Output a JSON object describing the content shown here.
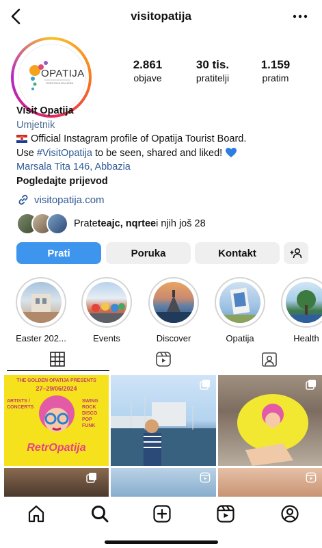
{
  "header": {
    "title": "visitopatija"
  },
  "profile": {
    "logo_text": "OPATIJA",
    "logo_sub": "OPATIJSKA RIVIJERA",
    "stats": [
      {
        "value": "2.861",
        "label": "objave"
      },
      {
        "value": "30 tis.",
        "label": "pratitelji"
      },
      {
        "value": "1.159",
        "label": "pratim"
      }
    ],
    "name": "Visit Opatija",
    "category": "Umjetnik",
    "bio_line1": "Official Instagram profile of Opatija Tourist Board.",
    "bio_use": "Use ",
    "bio_hashtag": "#VisitOpatija",
    "bio_rest": " to be seen, shared and liked!",
    "address": "Marsala Tita 146, Abbazia",
    "translate": "Pogledajte prijevod",
    "website": "visitopatija.com",
    "followed_prefix": "Prate ",
    "followed_names": "teajc, nqrtee",
    "followed_suffix": " i njih još 28"
  },
  "buttons": {
    "follow": "Prati",
    "message": "Poruka",
    "contact": "Kontakt"
  },
  "highlights": [
    {
      "label": "Easter 202..."
    },
    {
      "label": "Events"
    },
    {
      "label": "Discover"
    },
    {
      "label": "Opatija"
    },
    {
      "label": "Health"
    }
  ],
  "post1": {
    "line1": "THE GOLDEN OPATIJA PRESENTS",
    "dates": "27–29/06/2024",
    "left_text": "ARTISTS / CONCERTS",
    "right_text": "SWING ROCK DISCO POP FUNK",
    "brand": "RetrOpatija"
  },
  "colors": {
    "accent": "#3e95ee",
    "link": "#2f5a95",
    "poster_yellow": "#f5e21c"
  }
}
